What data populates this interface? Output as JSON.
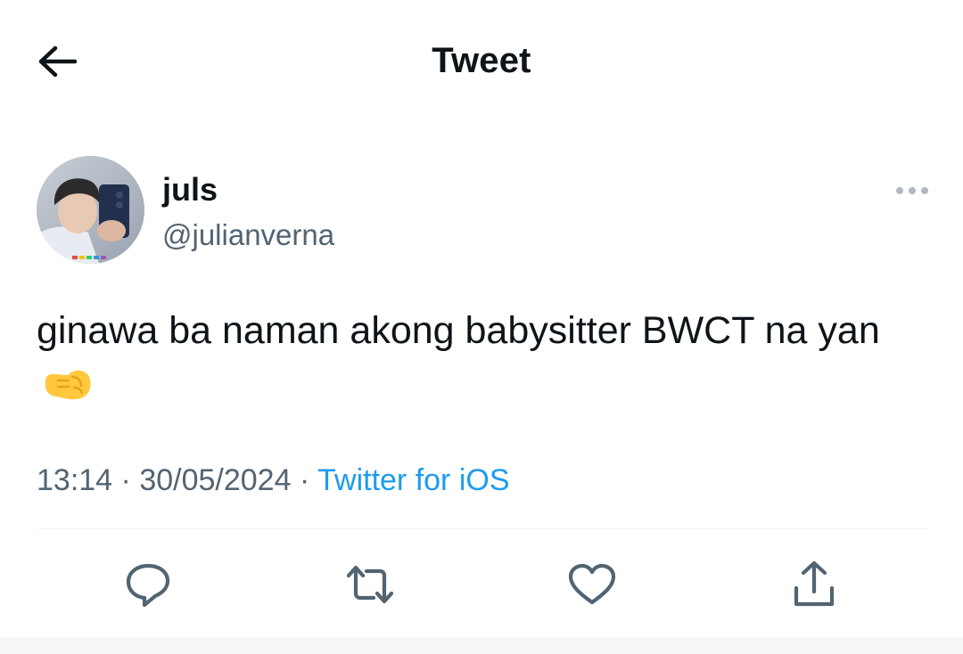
{
  "header": {
    "title": "Tweet",
    "back_icon": "arrow-left-icon"
  },
  "author": {
    "display_name": "juls",
    "handle": "@julianverna",
    "avatar_icon": "profile-photo"
  },
  "tweet": {
    "text": "ginawa ba naman akong babysitter BWCT na yan",
    "emoji": "fist-bump-emoji"
  },
  "meta": {
    "time": "13:14",
    "separator": "·",
    "date": "30/05/2024",
    "source": "Twitter for iOS"
  },
  "actions": [
    {
      "name": "reply",
      "icon": "reply-icon"
    },
    {
      "name": "retweet",
      "icon": "retweet-icon"
    },
    {
      "name": "like",
      "icon": "heart-icon"
    },
    {
      "name": "share",
      "icon": "share-icon"
    }
  ],
  "colors": {
    "text": "#0f1419",
    "secondary": "#536471",
    "link": "#1d9bf0",
    "divider": "#eff3f4"
  }
}
